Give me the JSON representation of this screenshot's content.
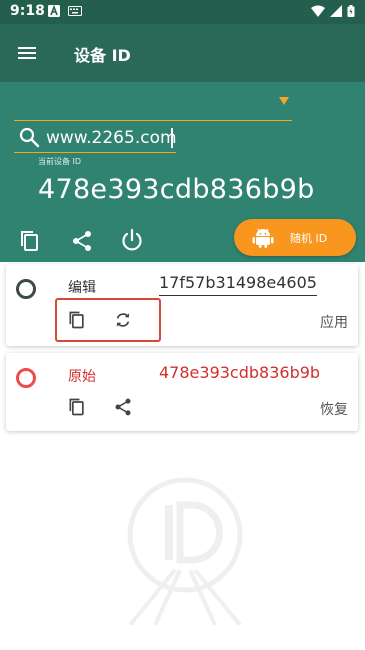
{
  "status_bar": {
    "time": "9:18",
    "icons": [
      "a-badge-icon",
      "keyboard-icon",
      "wifi-icon",
      "signal-icon",
      "battery-icon"
    ]
  },
  "app_bar": {
    "title": "设备 ID",
    "menu_icon": "menu-icon"
  },
  "header": {
    "search": {
      "value": "www.2265.com"
    },
    "current_id_label": "当前设备 ID",
    "current_id": "478e393cdb836b9b",
    "icons": [
      "copy-icon",
      "share-icon",
      "power-icon"
    ],
    "random_button": {
      "label": "随机 ID",
      "icon": "android-icon"
    }
  },
  "cards": [
    {
      "label": "编辑",
      "value": "17f57b31498e4605",
      "action": "应用",
      "icons": [
        "copy-icon",
        "refresh-icon"
      ],
      "highlighted": true,
      "color": "#333333",
      "radio_color": "#3d4a4a"
    },
    {
      "label": "原始",
      "value": "478e393cdb836b9b",
      "action": "恢复",
      "icons": [
        "copy-icon",
        "share-icon"
      ],
      "highlighted": false,
      "color": "#d32f2f",
      "radio_color": "#f04a4a"
    }
  ],
  "colors": {
    "status_bar": "#245f4e",
    "app_bar": "#2a6958",
    "header": "#2f8370",
    "accent": "#f5a623",
    "random_button": "#f8961e",
    "highlight_box": "#d64a3a"
  }
}
